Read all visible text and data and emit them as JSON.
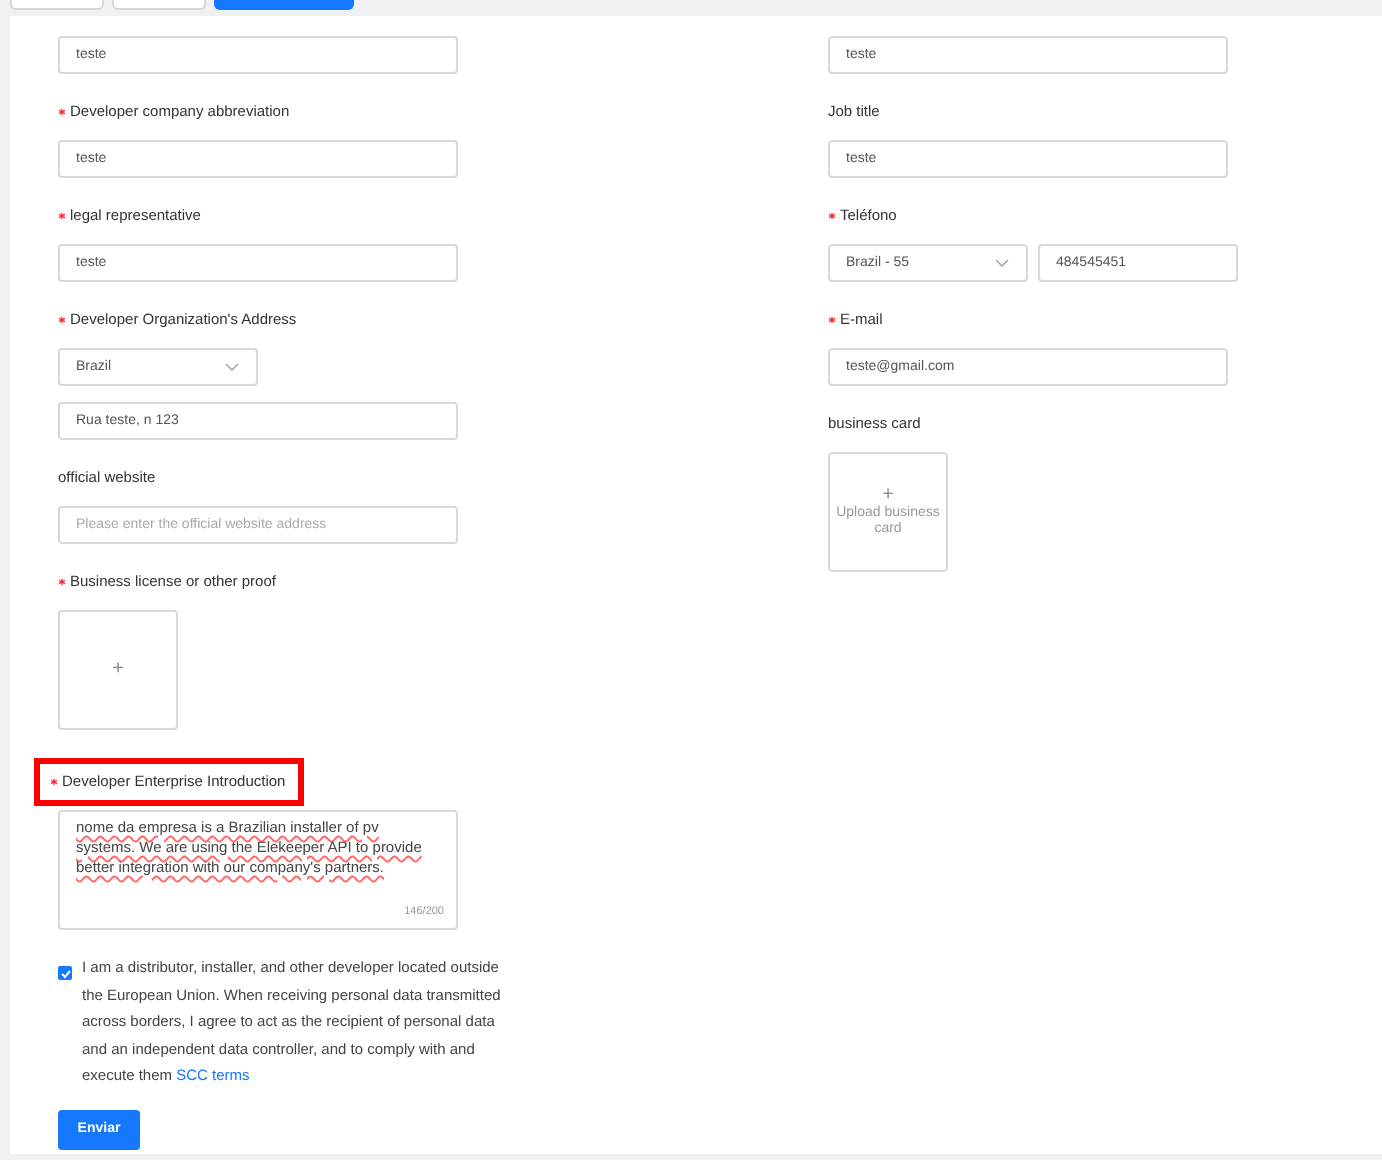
{
  "tabs": [
    {
      "selected": false
    },
    {
      "selected": false
    },
    {
      "selected": true
    }
  ],
  "left_fields": [
    {
      "kind": "input",
      "value": "teste"
    },
    {
      "kind": "input",
      "label": "Developer company abbreviation",
      "required": true,
      "value": "teste"
    },
    {
      "kind": "input",
      "label": "legal representative",
      "required": true,
      "value": "teste"
    },
    {
      "kind": "address",
      "label": "Developer Organization's Address",
      "required": true,
      "country": "Brazil",
      "value": "Rua teste, n 123"
    },
    {
      "kind": "input",
      "label": "official website",
      "required": false,
      "placeholder": "Please enter the official website address"
    },
    {
      "kind": "upload",
      "label": "Business license or other proof",
      "required": true,
      "icon_text": "+"
    },
    {
      "kind": "textarea",
      "label": "Developer Enterprise Introduction",
      "required": true,
      "highlighted": true,
      "value": " nome da empresa is a Brazilian installer of pv systems. We are using the Elekeeper API to provide better integration with our company's partners.",
      "counter": "146/200"
    }
  ],
  "right_fields": [
    {
      "kind": "input",
      "value": "teste"
    },
    {
      "kind": "input",
      "label": "Job title",
      "required": false,
      "value": "teste"
    },
    {
      "kind": "phone",
      "label": "Teléfono",
      "required": true,
      "country_code": "Brazil - 55",
      "value": "484545451"
    },
    {
      "kind": "input",
      "label": "E-mail",
      "required": true,
      "value": "teste@gmail.com"
    },
    {
      "kind": "upload",
      "label": "business card",
      "required": false,
      "icon_text": "+",
      "caption": "Upload business card"
    }
  ],
  "agreement": {
    "checked": true,
    "text": "I am a distributor, installer, and other developer located outside the European Union. When receiving personal data transmitted across borders, I agree to act as the recipient of personal data and an independent data controller, and to comply with and execute them",
    "link": "SCC terms"
  },
  "submit_button": "Enviar"
}
